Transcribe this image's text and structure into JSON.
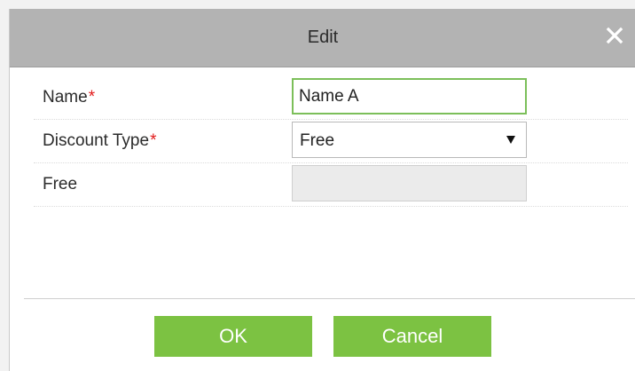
{
  "dialog": {
    "title": "Edit",
    "close_icon": "close-icon",
    "accent_color": "#7cc242",
    "required_marker_color": "#e21b1b"
  },
  "form": {
    "name": {
      "label": "Name",
      "required": "*",
      "value": "Name A"
    },
    "discount_type": {
      "label": "Discount Type",
      "required": "*",
      "selected": "Free"
    },
    "free": {
      "label": "Free",
      "value": ""
    }
  },
  "buttons": {
    "ok_label": "OK",
    "cancel_label": "Cancel"
  }
}
